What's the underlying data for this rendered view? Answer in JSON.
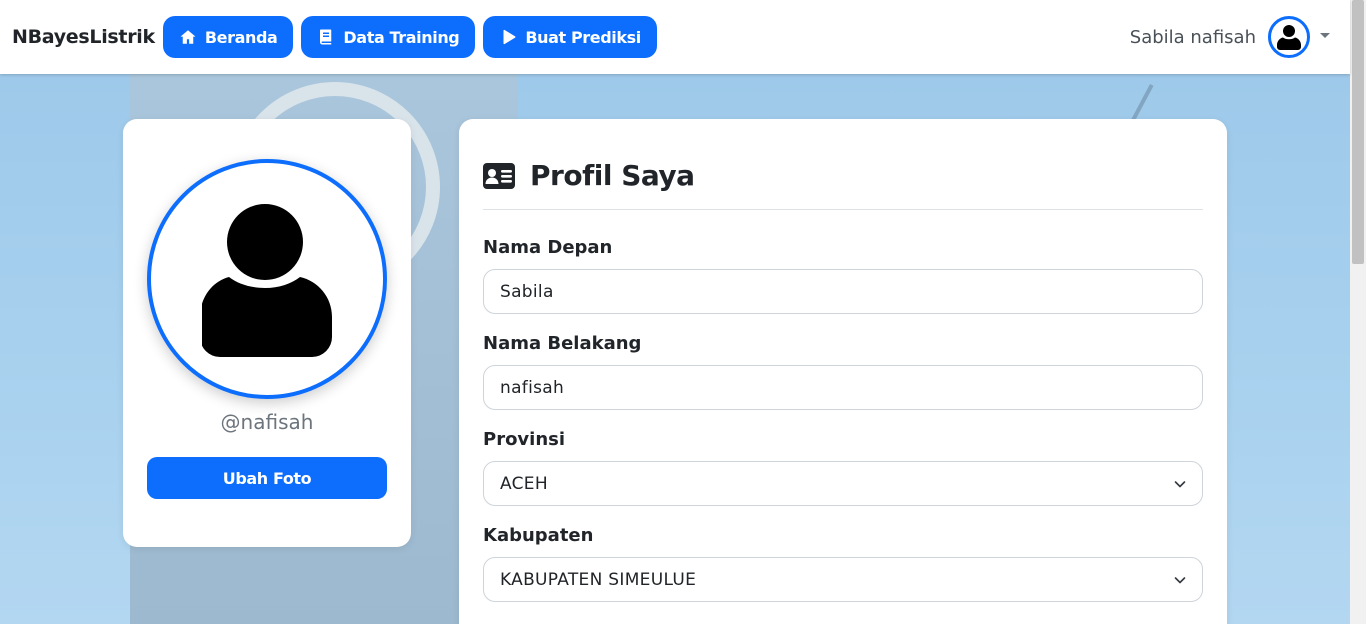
{
  "navbar": {
    "brand": "NBayesListrik",
    "items": [
      {
        "label": "Beranda",
        "icon": "home-icon"
      },
      {
        "label": "Data Training",
        "icon": "book-icon"
      },
      {
        "label": "Buat Prediksi",
        "icon": "play-icon"
      }
    ],
    "user_name": "Sabila nafisah",
    "avatar_icon": "user-icon"
  },
  "profile": {
    "username": "@nafisah",
    "change_photo_label": "Ubah Foto"
  },
  "form": {
    "title": "Profil Saya",
    "title_icon": "id-card-icon",
    "fields": [
      {
        "label": "Nama Depan",
        "value": "Sabila",
        "type": "text"
      },
      {
        "label": "Nama Belakang",
        "value": "nafisah",
        "type": "text"
      },
      {
        "label": "Provinsi",
        "value": "ACEH",
        "type": "select"
      },
      {
        "label": "Kabupaten",
        "value": "KABUPATEN SIMEULUE",
        "type": "select"
      }
    ]
  },
  "colors": {
    "primary": "#0d6efd",
    "text": "#212529",
    "muted": "#6c757d"
  }
}
